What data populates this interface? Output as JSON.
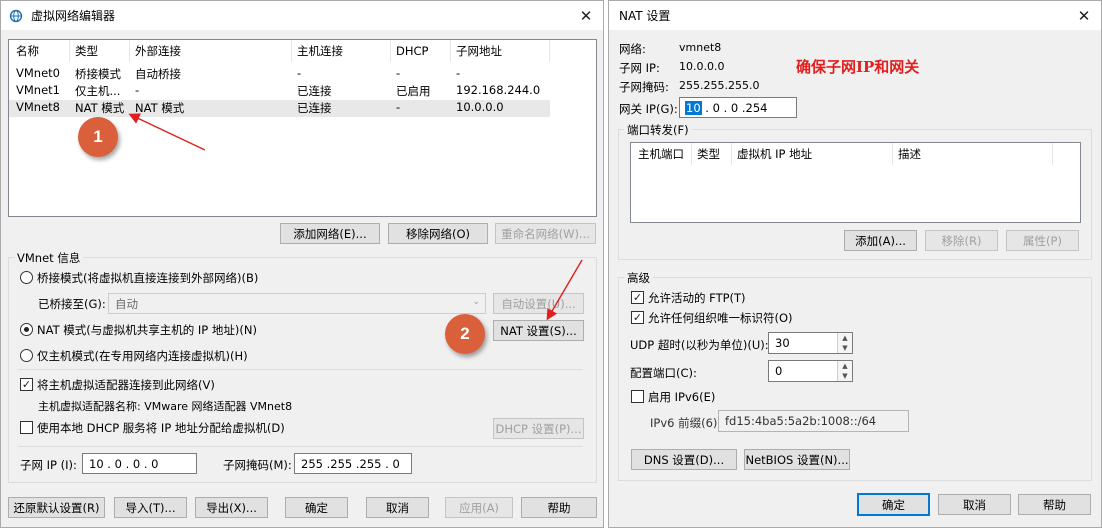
{
  "colors": {
    "accent": "#0078d7",
    "annotation_red": "#e0201e",
    "badge": "#d9603b",
    "note_red": "#e02020"
  },
  "left_window": {
    "title": "虚拟网络编辑器",
    "icon": "globe-network-icon",
    "table": {
      "headers": [
        "名称",
        "类型",
        "外部连接",
        "主机连接",
        "DHCP",
        "子网地址"
      ],
      "rows": [
        [
          "VMnet0",
          "桥接模式",
          "自动桥接",
          "-",
          "-",
          "-"
        ],
        [
          "VMnet1",
          "仅主机...",
          "-",
          "已连接",
          "已启用",
          "192.168.244.0"
        ],
        [
          "VMnet8",
          "NAT 模式",
          "NAT 模式",
          "已连接",
          "-",
          "10.0.0.0"
        ]
      ]
    },
    "list_buttons": {
      "add": "添加网络(E)...",
      "remove": "移除网络(O)",
      "rename": "重命名网络(W)..."
    },
    "vmnet_info": {
      "group_label": "VMnet 信息",
      "bridge_radio": "桥接模式(将虚拟机直接连接到外部网络)(B)",
      "bridged_to_label": "已桥接至(G):",
      "bridged_to_value": "自动",
      "auto_settings": "自动设置(U)...",
      "nat_radio": "NAT 模式(与虚拟机共享主机的 IP 地址)(N)",
      "nat_settings": "NAT 设置(S)...",
      "hostonly_radio": "仅主机模式(在专用网络内连接虚拟机)(H)",
      "connect_adapter": "将主机虚拟适配器连接到此网络(V)",
      "adapter_name": "主机虚拟适配器名称: VMware 网络适配器 VMnet8",
      "use_dhcp": "使用本地 DHCP 服务将 IP 地址分配给虚拟机(D)",
      "dhcp_settings": "DHCP 设置(P)...",
      "subnet_ip_label": "子网 IP (I):",
      "subnet_ip_value": "10 . 0 . 0 . 0",
      "subnet_mask_label": "子网掩码(M):",
      "subnet_mask_value": "255 .255 .255 . 0"
    },
    "bottom_buttons": {
      "restore": "还原默认设置(R)",
      "import": "导入(T)...",
      "export": "导出(X)...",
      "ok": "确定",
      "cancel": "取消",
      "apply": "应用(A)",
      "help": "帮助"
    },
    "annotations": {
      "badge1": "1",
      "badge2": "2"
    }
  },
  "right_window": {
    "title": "NAT 设置",
    "network_label": "网络:",
    "network_value": "vmnet8",
    "subnet_ip_label": "子网 IP:",
    "subnet_ip_value": "10.0.0.0",
    "subnet_mask_label": "子网掩码:",
    "subnet_mask_value": "255.255.255.0",
    "note": "确保子网IP和网关",
    "gateway_label": "网关 IP(G):",
    "gateway_value_selected": "10",
    "gateway_value_rest": " . 0 . 0 .254",
    "port_forwarding": {
      "group_label": "端口转发(F)",
      "headers": [
        "主机端口",
        "类型",
        "虚拟机 IP 地址",
        "描述"
      ],
      "add": "添加(A)...",
      "remove": "移除(R)",
      "properties": "属性(P)"
    },
    "advanced": {
      "group_label": "高级",
      "allow_ftp": "允许活动的 FTP(T)",
      "allow_any_oui": "允许任何组织唯一标识符(O)",
      "udp_timeout_label": "UDP 超时(以秒为单位)(U):",
      "udp_timeout_value": "30",
      "config_port_label": "配置端口(C):",
      "config_port_value": "0",
      "enable_ipv6": "启用 IPv6(E)",
      "ipv6_prefix_label": "IPv6 前缀(6):",
      "ipv6_prefix_value": "fd15:4ba5:5a2b:1008::/64",
      "dns_settings": "DNS 设置(D)...",
      "netbios_settings": "NetBIOS 设置(N)..."
    },
    "bottom_buttons": {
      "ok": "确定",
      "cancel": "取消",
      "help": "帮助"
    }
  }
}
